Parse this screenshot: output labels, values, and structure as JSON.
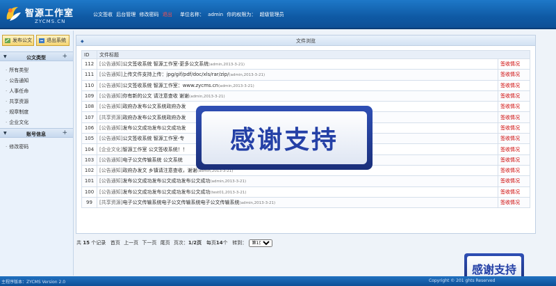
{
  "header": {
    "logo_title": "智源工作室",
    "logo_sub": "ZYCMS.CN",
    "nav": [
      {
        "label": "公文签收"
      },
      {
        "label": "后台管理"
      },
      {
        "label": "修改密码"
      },
      {
        "label": "退出"
      }
    ],
    "unit_label": "单位名称：",
    "unit_value": "admin",
    "role_label": "你的权限为：",
    "role_value": "超级管理员"
  },
  "sidebar": {
    "btn_publish": "发布公文",
    "btn_logout": "退出系统",
    "section1": "公文类型",
    "items": [
      "所有类型",
      "公告通知",
      "人事任命",
      "共享资源",
      "规章制度",
      "企业文化"
    ],
    "section2": "账号信息",
    "account_items": [
      "修改密码"
    ]
  },
  "main": {
    "title": "文件浏览",
    "col_id": "ID",
    "col_title": "文件标题",
    "rows": [
      {
        "id": "112",
        "cat": "[公告通知]",
        "text": "公文签收系统 智源工作室-更多公文系统",
        "meta": "(admin,2013-3-21)",
        "action": "签收情况"
      },
      {
        "id": "111",
        "cat": "[公告通知]",
        "text": "上传文件支持上传：jpg/gif/pdf/doc/xls/rar/zip/",
        "meta": "(admin,2013-3-21)",
        "action": "签收情况"
      },
      {
        "id": "110",
        "cat": "[公告通知]",
        "text": "公文签收系统 智源工作室：www.zycms.cn",
        "meta": "(admin,2013-3-21)",
        "action": "签收情况"
      },
      {
        "id": "109",
        "cat": "[公告通知]",
        "text": "你有新的公文 请注意查收 谢谢",
        "meta": "(admin,2013-3-21)",
        "action": "签收情况"
      },
      {
        "id": "108",
        "cat": "[公告通知]",
        "text": "政府办发布公文系统政府办发",
        "meta": "",
        "action": "签收情况"
      },
      {
        "id": "107",
        "cat": "[共享资源]",
        "text": "政府办发布公文系统政府办发",
        "meta": "",
        "action": "签收情况"
      },
      {
        "id": "106",
        "cat": "[公告通知]",
        "text": "发布公文成功发布公文成功发",
        "meta": "",
        "action": "签收情况"
      },
      {
        "id": "105",
        "cat": "[公告通知]",
        "text": "公文签收系统 智源工作室-专",
        "meta": "",
        "action": "签收情况"
      },
      {
        "id": "104",
        "cat": "[企业文化]",
        "text": "智源工作室 公文签收系统！！",
        "meta": "",
        "action": "签收情况"
      },
      {
        "id": "103",
        "cat": "[公告通知]",
        "text": "电子公文传输系统 公文系统",
        "meta": "",
        "action": "签收情况"
      },
      {
        "id": "102",
        "cat": "[公告通知]",
        "text": "政府办发文 乡镇请注意查收，谢谢",
        "meta": "(admin,2013-3-21)",
        "action": "签收情况"
      },
      {
        "id": "101",
        "cat": "[公告通知]",
        "text": "发布公文成功发布公文成功发布公文成功",
        "meta": "(admin,2013-3-21)",
        "action": "签收情况"
      },
      {
        "id": "100",
        "cat": "[公告通知]",
        "text": "发布公文成功发布公文成功发布公文成功",
        "meta": "(test01,2013-3-21)",
        "action": "签收情况"
      },
      {
        "id": "99",
        "cat": "[共享资源]",
        "text": "电子公文传输系统电子公文传输系统电子公文传输系统",
        "meta": "(admin,2013-3-21)",
        "action": "签收情况"
      }
    ]
  },
  "pager": {
    "total_prefix": "共",
    "total": "15",
    "total_suffix": "个记录",
    "first": "首页",
    "prev": "上一页",
    "next": "下一页",
    "last": "尾页",
    "page_label": "页次：",
    "page_value": "1/2页",
    "per_page_label": "每页",
    "per_page": "14",
    "per_page_suffix": "个",
    "goto_label": "转到：",
    "select_value": "第1页"
  },
  "overlay": {
    "big": "感谢支持",
    "small": "感谢支持"
  },
  "footer": {
    "left": "主程序版本：ZYCMS Version 2.0",
    "right": "Copyright © 201     ghts Reserved"
  },
  "colors": {
    "header": "#1e78c8",
    "action": "#cc0000",
    "overlay": "#2440a6"
  }
}
